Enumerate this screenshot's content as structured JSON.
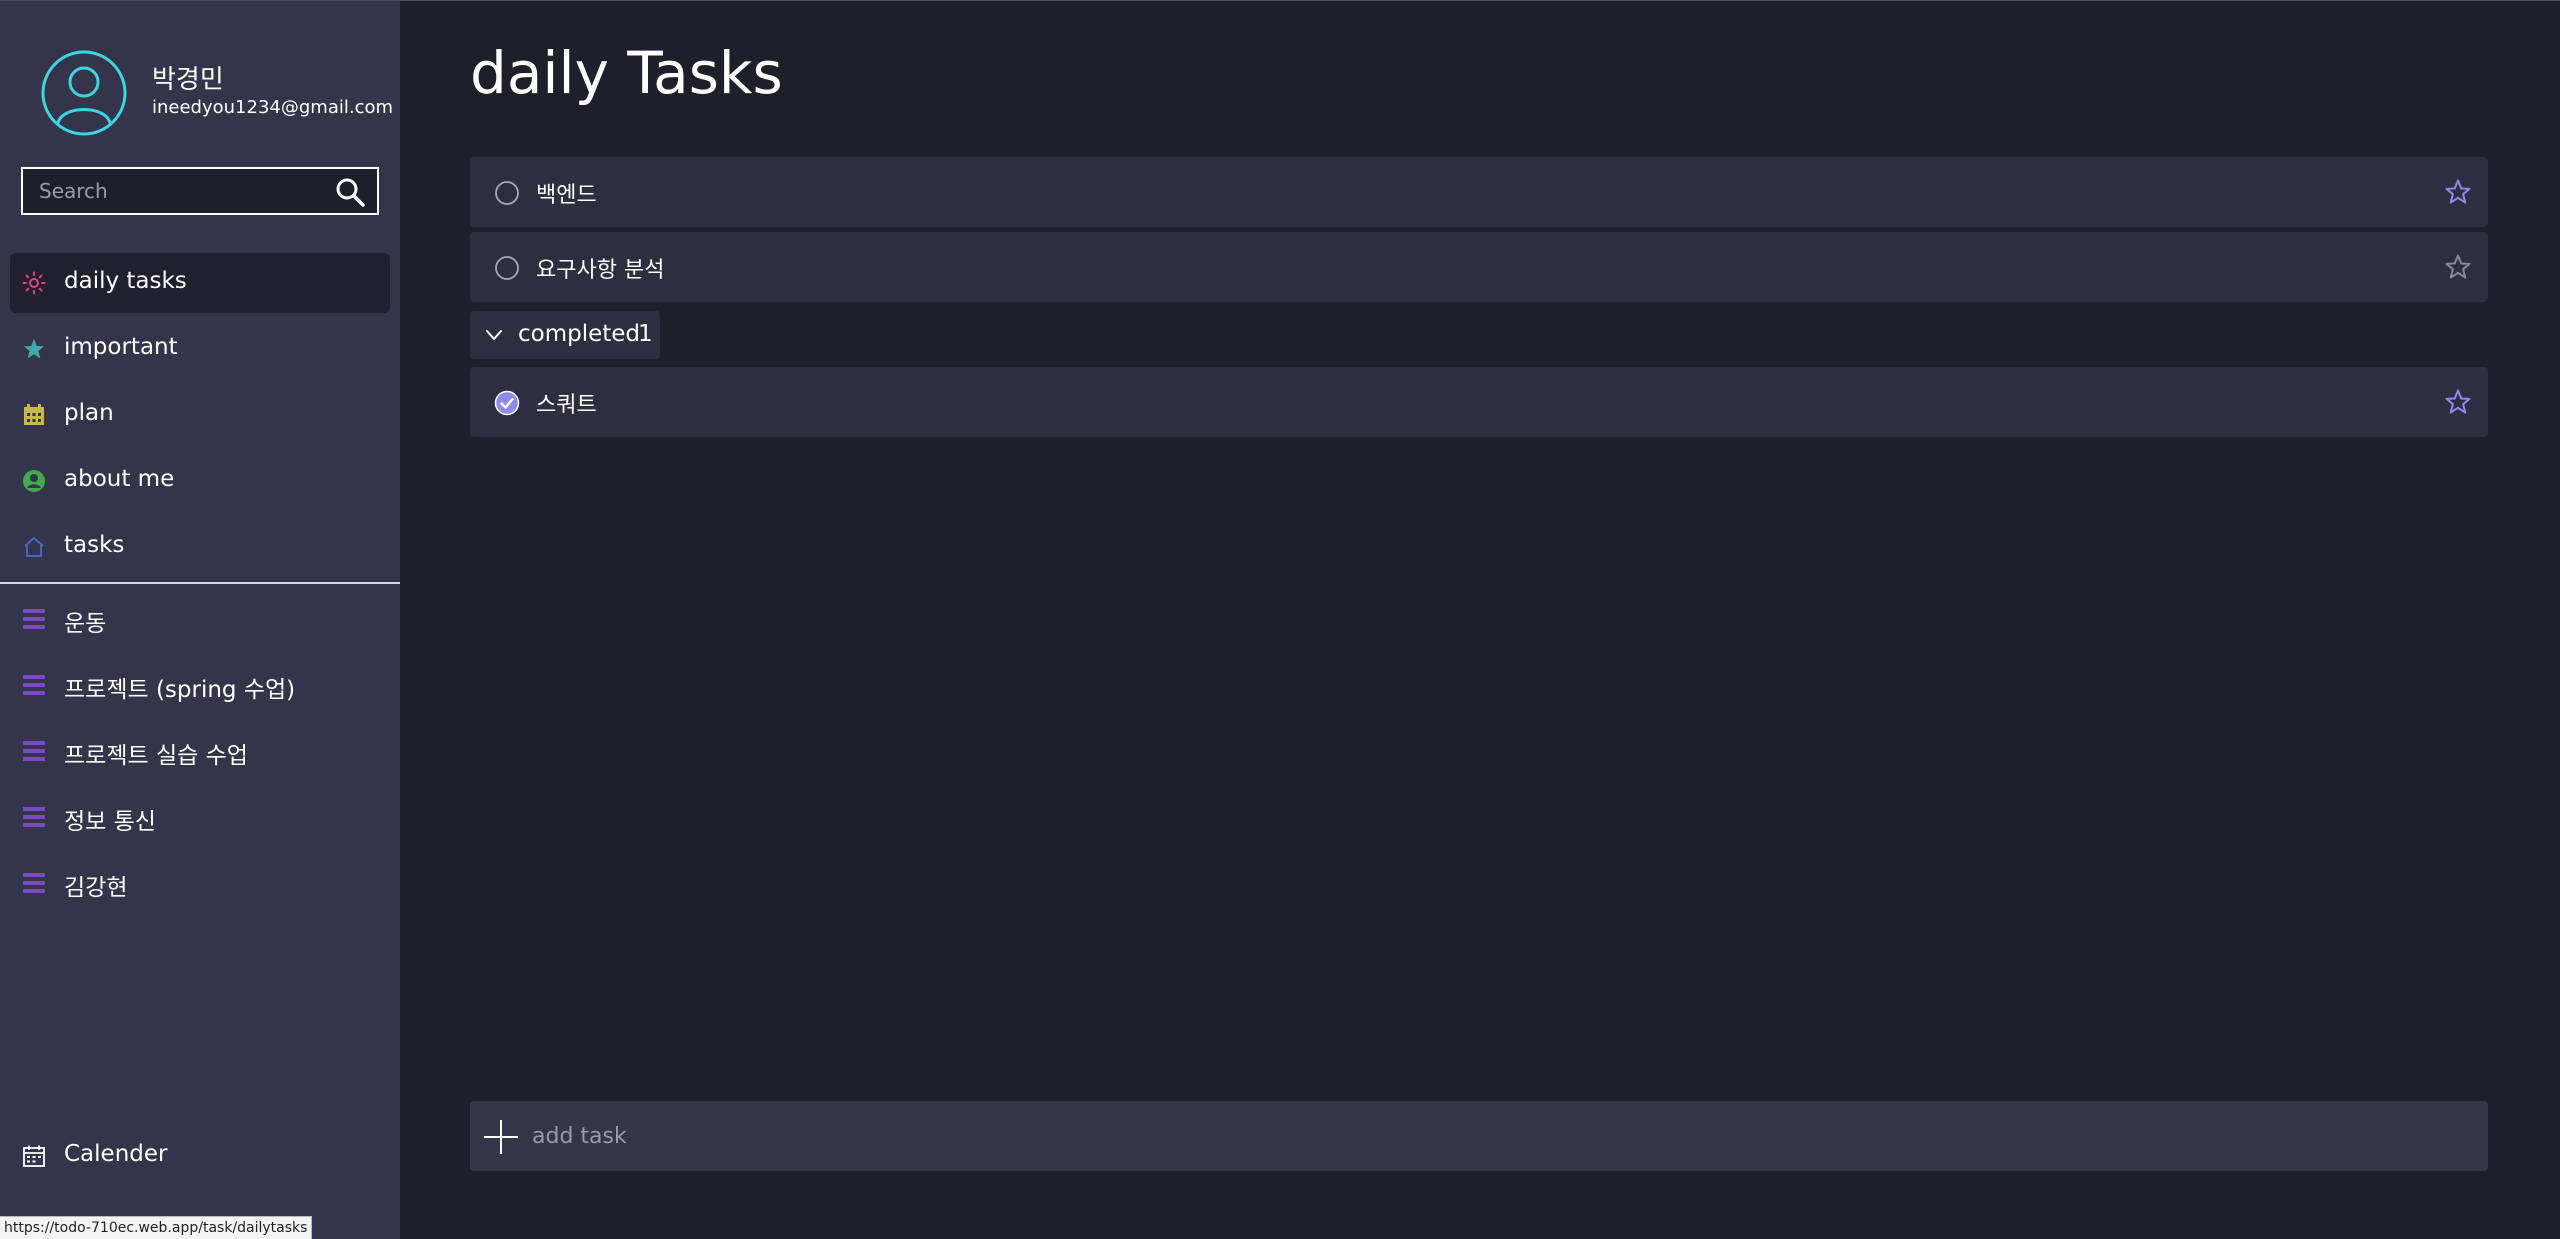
{
  "user": {
    "name": "박경민",
    "email": "ineedyou1234@gmail.com"
  },
  "search": {
    "placeholder": "Search"
  },
  "nav": {
    "items": [
      {
        "label": "daily tasks",
        "icon": "sun-icon",
        "color": "#e0457a",
        "active": true
      },
      {
        "label": "important",
        "icon": "star-icon",
        "color": "#3fa8a8",
        "active": false
      },
      {
        "label": "plan",
        "icon": "calendar-grid-icon",
        "color": "#c9b84a",
        "active": false
      },
      {
        "label": "about me",
        "icon": "user-circle-icon",
        "color": "#3fae4a",
        "active": false
      },
      {
        "label": "tasks",
        "icon": "home-icon",
        "color": "#4a63c8",
        "active": false
      }
    ]
  },
  "lists": {
    "icon": "list-icon",
    "color": "#7a4bc0",
    "items": [
      {
        "label": "운동"
      },
      {
        "label": "프로젝트 (spring 수업)"
      },
      {
        "label": "프로젝트 실습 수업"
      },
      {
        "label": "정보 통신"
      },
      {
        "label": "김강현"
      }
    ]
  },
  "bottom_nav": {
    "calendar_label": "Calender"
  },
  "status_bar": {
    "url": "https://todo-710ec.web.app/task/dailytasks"
  },
  "main": {
    "title": "daily Tasks",
    "tasks": [
      {
        "label": "백엔드",
        "completed": false,
        "important": true
      },
      {
        "label": "요구사항 분석",
        "completed": false,
        "important": false
      }
    ],
    "completed_section": {
      "label": "completed",
      "count": "1"
    },
    "completed_tasks": [
      {
        "label": "스쿼트",
        "completed": true,
        "important": true
      }
    ],
    "add_task": {
      "placeholder": "add task"
    }
  },
  "colors": {
    "sidebar_bg": "#34344a",
    "main_bg": "#1f1f2c",
    "task_bg": "#2e2e40",
    "accent": "#8b8bf0",
    "avatar": "#3ad6e0"
  }
}
